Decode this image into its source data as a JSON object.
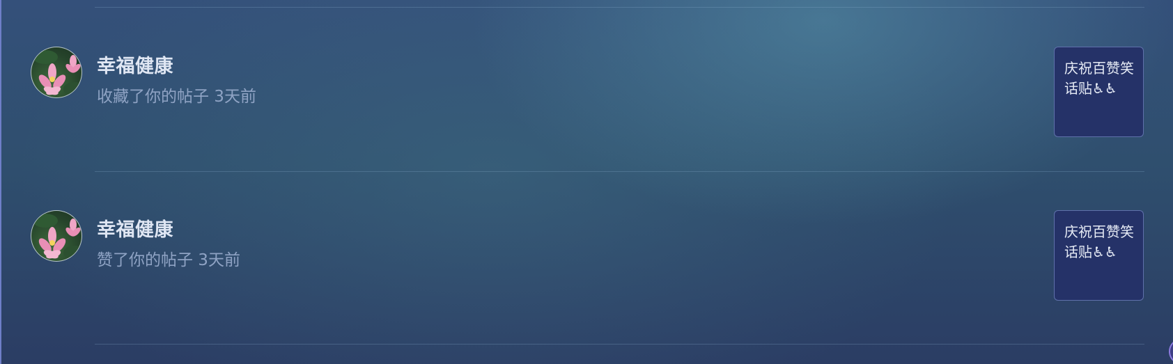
{
  "notifications": [
    {
      "username": "幸福健康",
      "action": "收藏了你的帖子 3天前",
      "post_title": "庆祝百赞笑话贴♿♿"
    },
    {
      "username": "幸福健康",
      "action": "赞了你的帖子 3天前",
      "post_title": "庆祝百赞笑话贴♿♿"
    }
  ],
  "colors": {
    "background_top": "#34507a",
    "background_bottom": "#2b3d64",
    "card_background": "#253268",
    "username_text": "#dfe6f3",
    "secondary_text": "#8fa3c4"
  },
  "icons": {
    "avatar": "lotus-flower-avatar",
    "corner": "circle-badge-icon"
  }
}
